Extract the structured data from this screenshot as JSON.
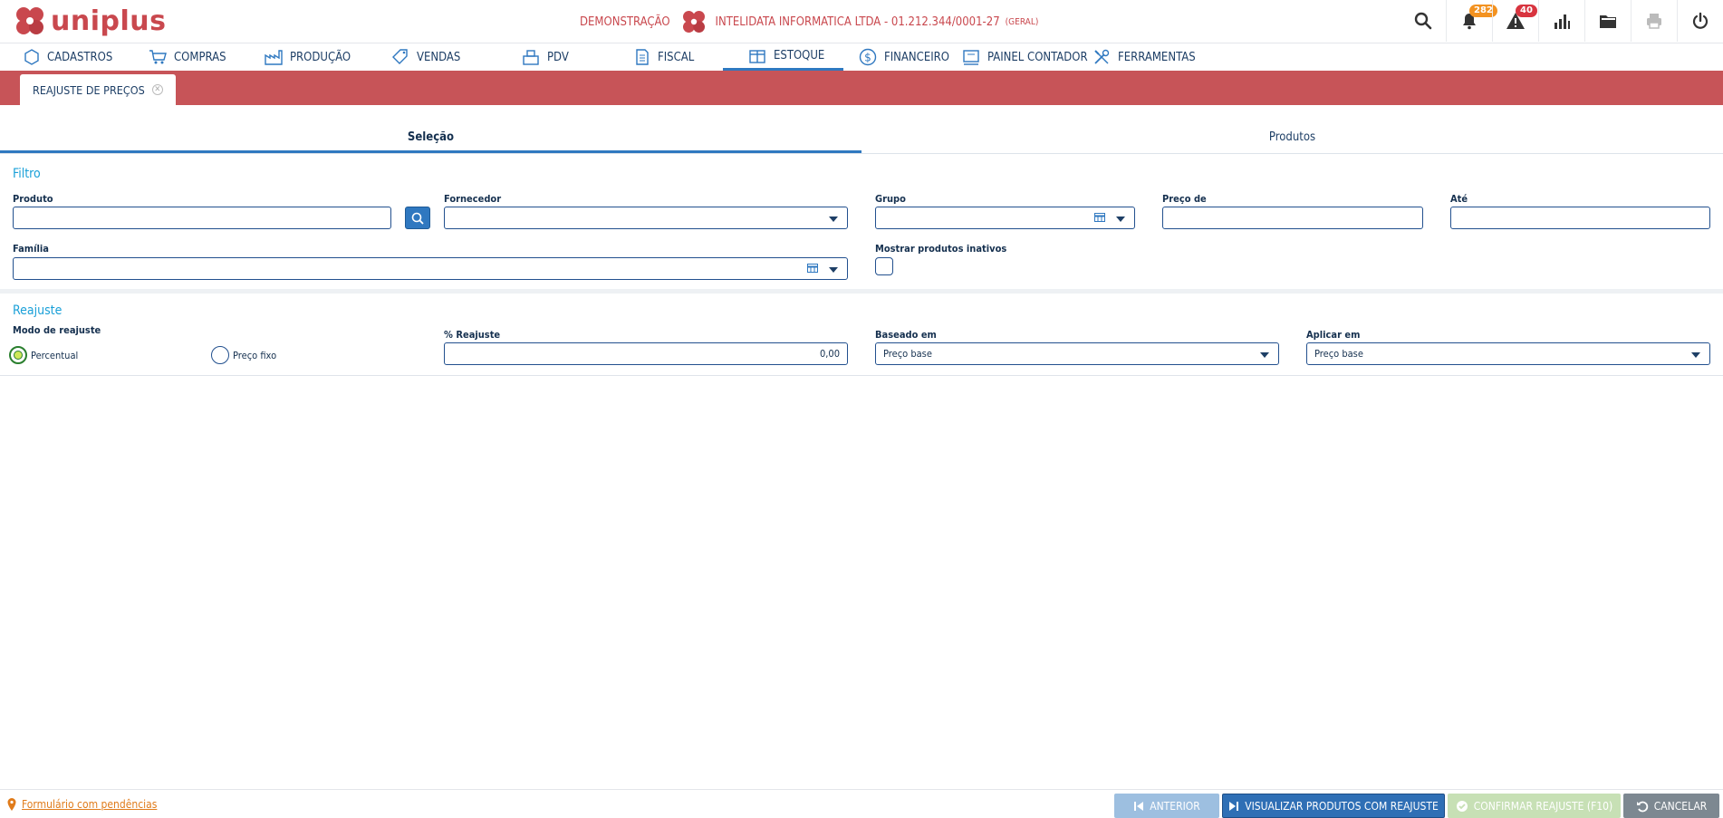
{
  "app": {
    "name": "uniplus"
  },
  "company": {
    "mode": "DEMONSTRAÇÃO",
    "name": "INTELIDATA INFORMATICA LTDA - 01.212.344/0001-27",
    "scope": "(GERAL)"
  },
  "top_icons": {
    "notifications_count": "282",
    "alerts_count": "40",
    "notifications_badge_color": "#f39220",
    "alerts_badge_color": "#d8343f"
  },
  "nav": {
    "items": [
      {
        "label": "CADASTROS",
        "icon": "cube-icon"
      },
      {
        "label": "COMPRAS",
        "icon": "cart-icon"
      },
      {
        "label": "PRODUÇÃO",
        "icon": "factory-icon"
      },
      {
        "label": "VENDAS",
        "icon": "tag-icon"
      },
      {
        "label": "PDV",
        "icon": "register-icon"
      },
      {
        "label": "FISCAL",
        "icon": "document-icon"
      },
      {
        "label": "ESTOQUE",
        "icon": "box-icon"
      },
      {
        "label": "FINANCEIRO",
        "icon": "dollar-icon"
      },
      {
        "label": "PAINEL CONTADOR",
        "icon": "book-icon"
      },
      {
        "label": "FERRAMENTAS",
        "icon": "tools-icon"
      }
    ],
    "active": "ESTOQUE"
  },
  "page_tab": {
    "label": "REAJUSTE DE PREÇOS"
  },
  "tabs": [
    {
      "label": "Seleção",
      "active": true
    },
    {
      "label": "Produtos",
      "active": false
    }
  ],
  "filter": {
    "title": "Filtro",
    "produto_label": "Produto",
    "produto_value": "",
    "fornecedor_label": "Fornecedor",
    "fornecedor_value": "",
    "grupo_label": "Grupo",
    "grupo_value": "",
    "preco_de_label": "Preço de",
    "preco_de_value": "",
    "ate_label": "Até",
    "ate_value": "",
    "familia_label": "Família",
    "familia_value": "",
    "mostrar_inativos_label": "Mostrar produtos inativos",
    "mostrar_inativos_checked": false
  },
  "reajuste": {
    "title": "Reajuste",
    "modo_label": "Modo de reajuste",
    "modo_options": [
      "Percentual",
      "Preço fixo"
    ],
    "modo_selected": "Percentual",
    "percent_label": "% Reajuste",
    "percent_value": "0,00",
    "baseado_label": "Baseado em",
    "baseado_value": "Preço base",
    "aplicar_label": "Aplicar em",
    "aplicar_value": "Preço base"
  },
  "footer": {
    "pending_text": "Formulário com pendências",
    "anterior": "ANTERIOR",
    "visualizar": "VISUALIZAR PRODUTOS COM REAJUSTE",
    "confirmar": "CONFIRMAR REAJUSTE (F10)",
    "cancelar": "CANCELAR"
  },
  "colors": {
    "brand": "#c9484e",
    "accent_blue": "#2f78c0",
    "section_title": "#1aa0d8",
    "header_strip": "#c75458"
  }
}
